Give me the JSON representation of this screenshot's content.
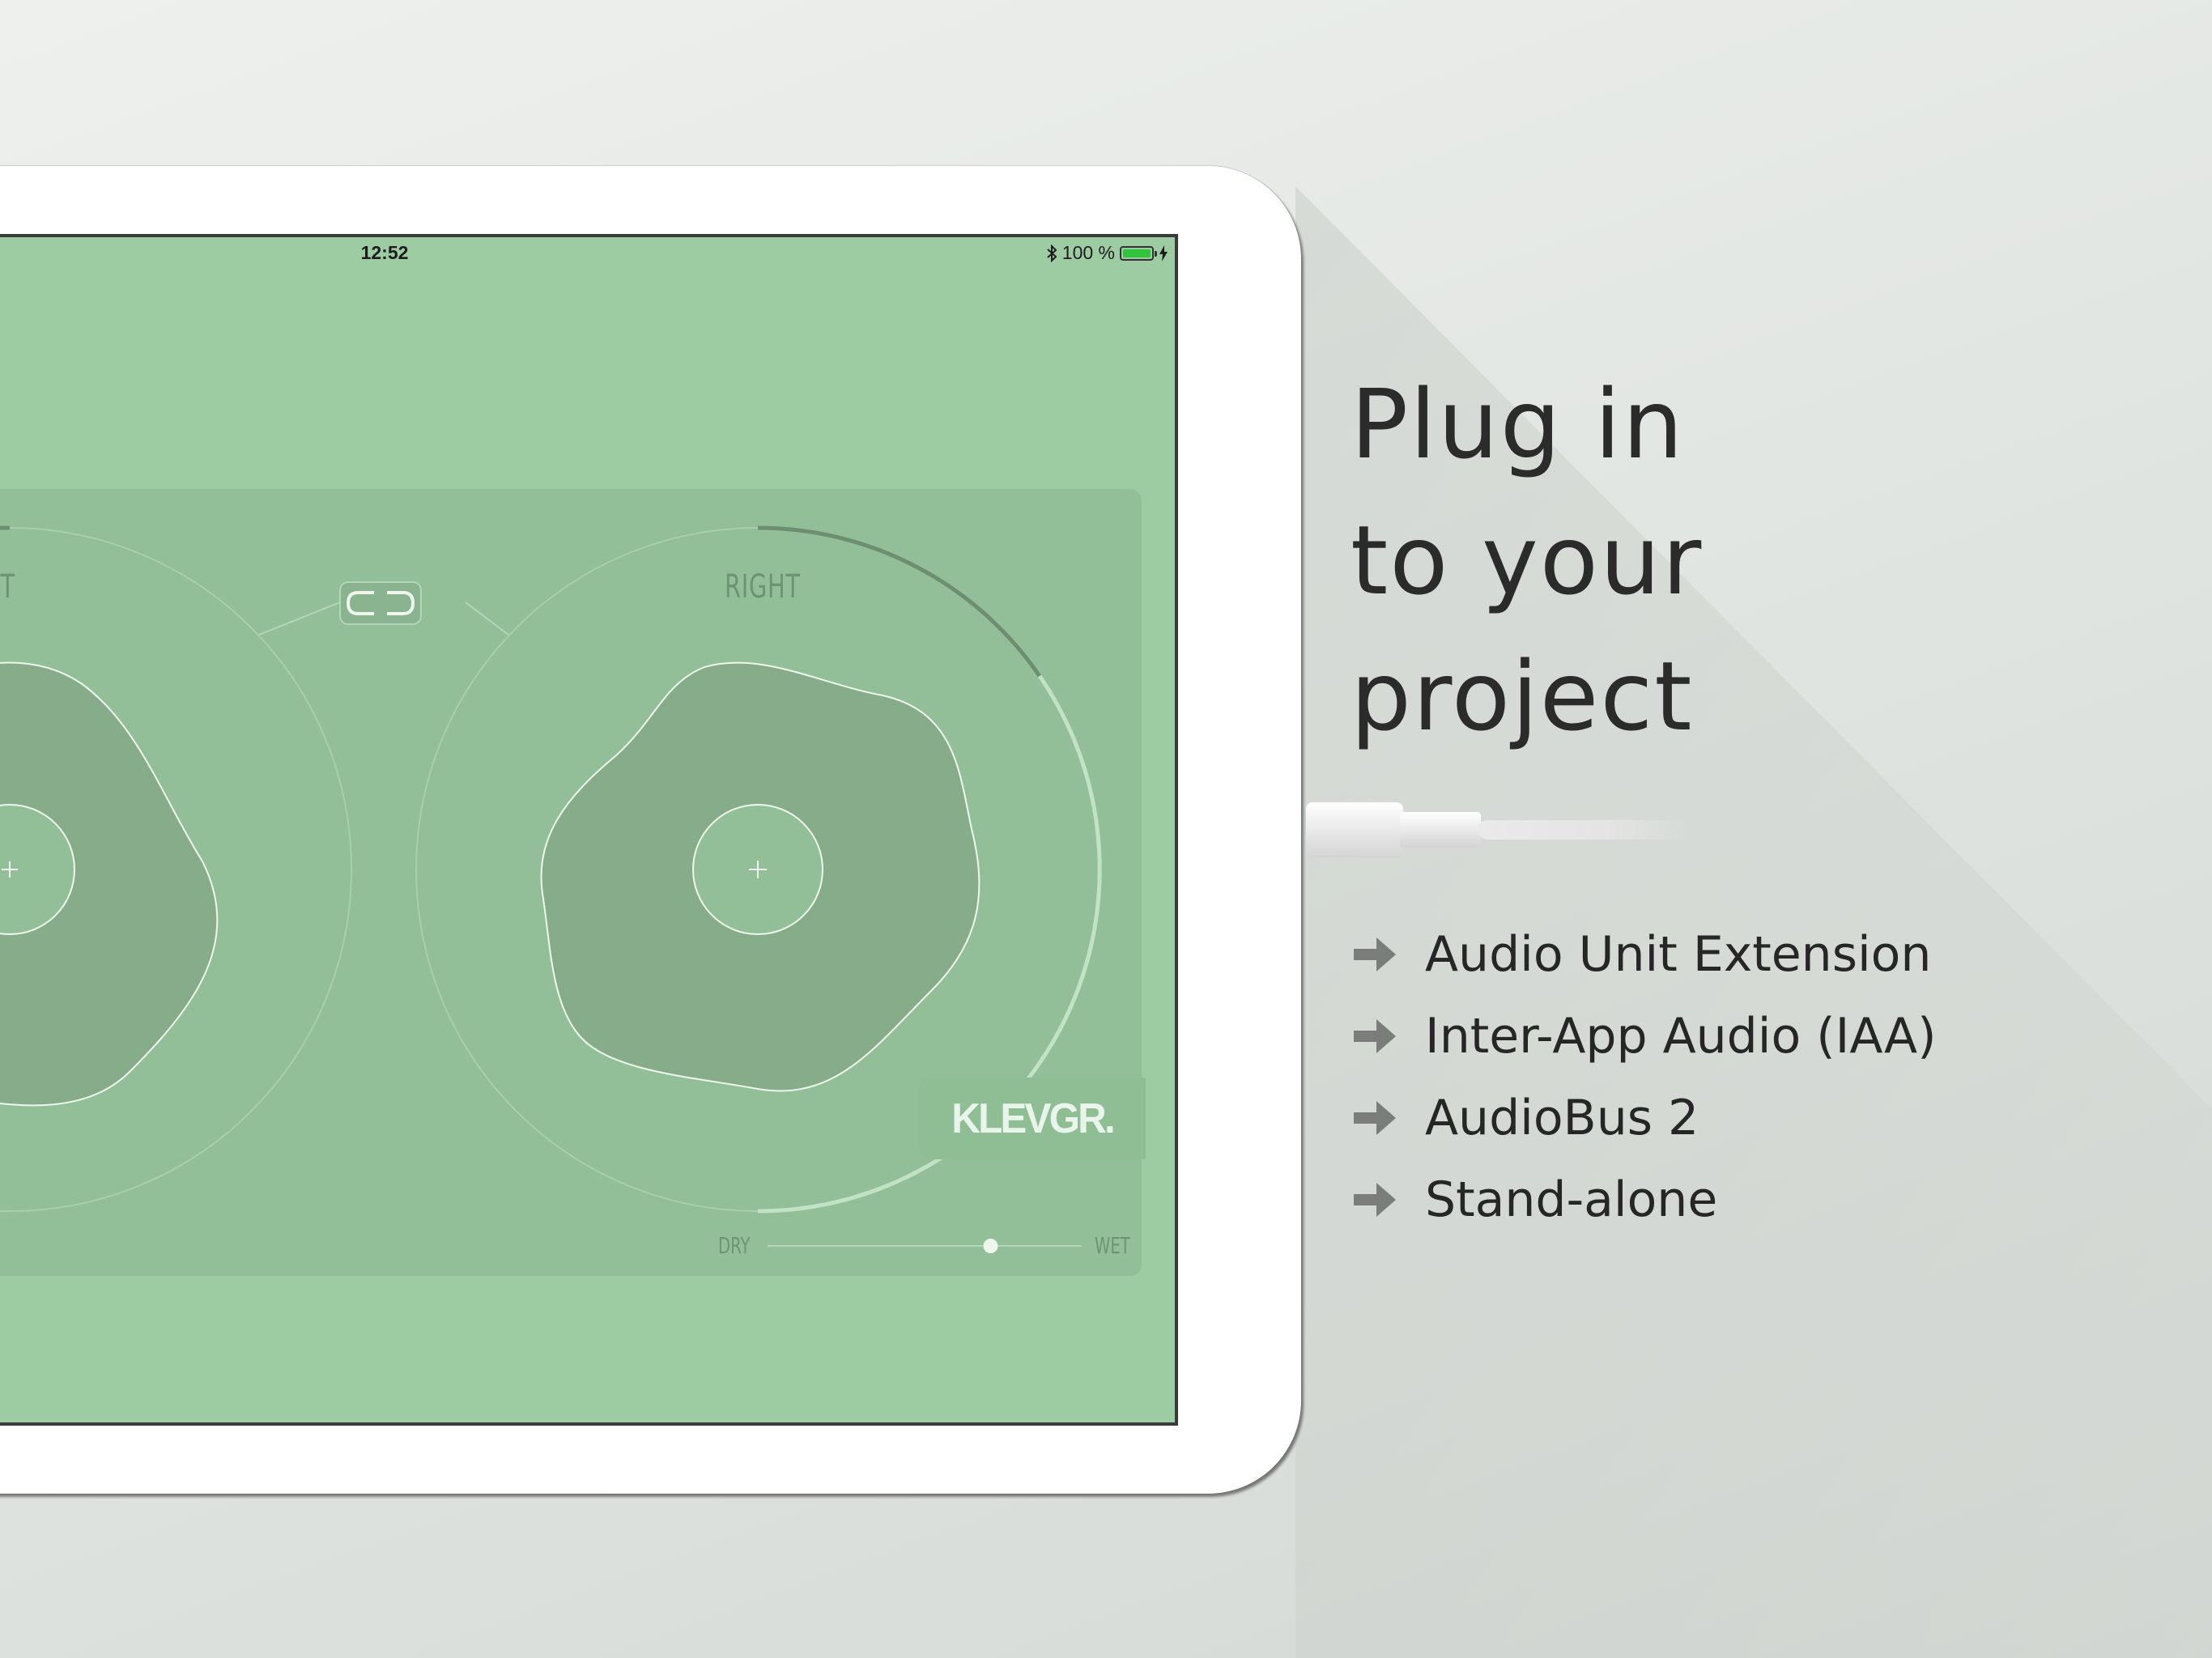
{
  "headline": {
    "lines": [
      "Plug in",
      "to your",
      "project"
    ]
  },
  "features": [
    {
      "label": "Audio Unit Extension",
      "icon": "arrow-right-icon"
    },
    {
      "label": "Inter-App Audio (IAA)",
      "icon": "arrow-right-icon"
    },
    {
      "label": "AudioBus 2",
      "icon": "arrow-right-icon"
    },
    {
      "label": "Stand-alone",
      "icon": "arrow-right-icon"
    }
  ],
  "device": {
    "statusbar": {
      "time": "12:52",
      "battery_text": "100 %",
      "bluetooth_icon": "bluetooth-icon",
      "battery_icon": "battery-icon",
      "battery_color": "#33c43f"
    },
    "app": {
      "channels": {
        "left_label": "LEFT",
        "right_label": "RIGHT",
        "link_icon": "link-icon",
        "center_icon": "plus-icon"
      },
      "mix": {
        "dry_label": "DRY",
        "wet_label": "WET",
        "value": 0.71
      },
      "brand": "KLEVGR."
    }
  },
  "colors": {
    "screen_bg": "#9dcba2",
    "panel_bg": "#93bf98",
    "blob_fill": "#86ac8a",
    "text_dark": "#2b2b2b"
  }
}
